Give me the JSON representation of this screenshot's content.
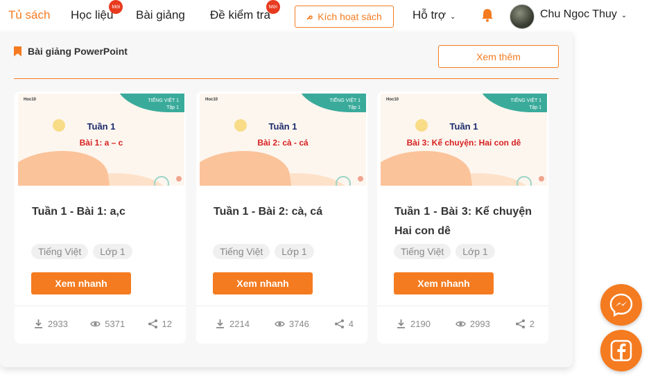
{
  "nav": {
    "items": [
      {
        "label": "Tủ sách",
        "active": true
      },
      {
        "label": "Học liệu",
        "badge": "Mới"
      },
      {
        "label": "Bài giảng"
      },
      {
        "label": "Đề kiểm tra",
        "badge": "Mới"
      }
    ],
    "activate_label": "Kích hoạt sách",
    "support_label": "Hỗ trợ",
    "user_name": "Chu Ngoc Thuy"
  },
  "section": {
    "title": "Bài giảng PowerPoint",
    "more_label": "Xem thêm"
  },
  "cards": [
    {
      "thumb": {
        "brand": "Hoc10",
        "subject": "TIẾNG VIỆT 1",
        "volume": "Tập 1",
        "week": "Tuần 1",
        "lesson": "Bài 1: a – c"
      },
      "title": "Tuần 1 - Bài 1: a,c",
      "tags": [
        "Tiếng Việt",
        "Lớp 1"
      ],
      "button": "Xem nhanh",
      "downloads": "2933",
      "views": "5371",
      "shares": "12"
    },
    {
      "thumb": {
        "brand": "Hoc10",
        "subject": "TIẾNG VIỆT 1",
        "volume": "Tập 1",
        "week": "Tuần 1",
        "lesson": "Bài 2: cà - cá"
      },
      "title": "Tuần 1 - Bài 2: cà, cá",
      "tags": [
        "Tiếng Việt",
        "Lớp 1"
      ],
      "button": "Xem nhanh",
      "downloads": "2214",
      "views": "3746",
      "shares": "4"
    },
    {
      "thumb": {
        "brand": "Hoc10",
        "subject": "TIẾNG VIỆT 1",
        "volume": "Tập 1",
        "week": "Tuần 1",
        "lesson": "Bài 3: Kể chuyện: Hai con dê"
      },
      "title": "Tuần 1 - Bài 3: Kể chuyện Hai con dê",
      "tags": [
        "Tiếng Việt",
        "Lớp 1"
      ],
      "button": "Xem nhanh",
      "downloads": "2190",
      "views": "2993",
      "shares": "2"
    }
  ],
  "colors": {
    "accent": "#f47b20",
    "badge": "#e83a1e",
    "teal": "#3aab9b"
  },
  "icons": [
    "bell-icon",
    "bookmark-icon",
    "download-icon",
    "eye-icon",
    "share-icon",
    "messenger-icon",
    "facebook-icon"
  ]
}
